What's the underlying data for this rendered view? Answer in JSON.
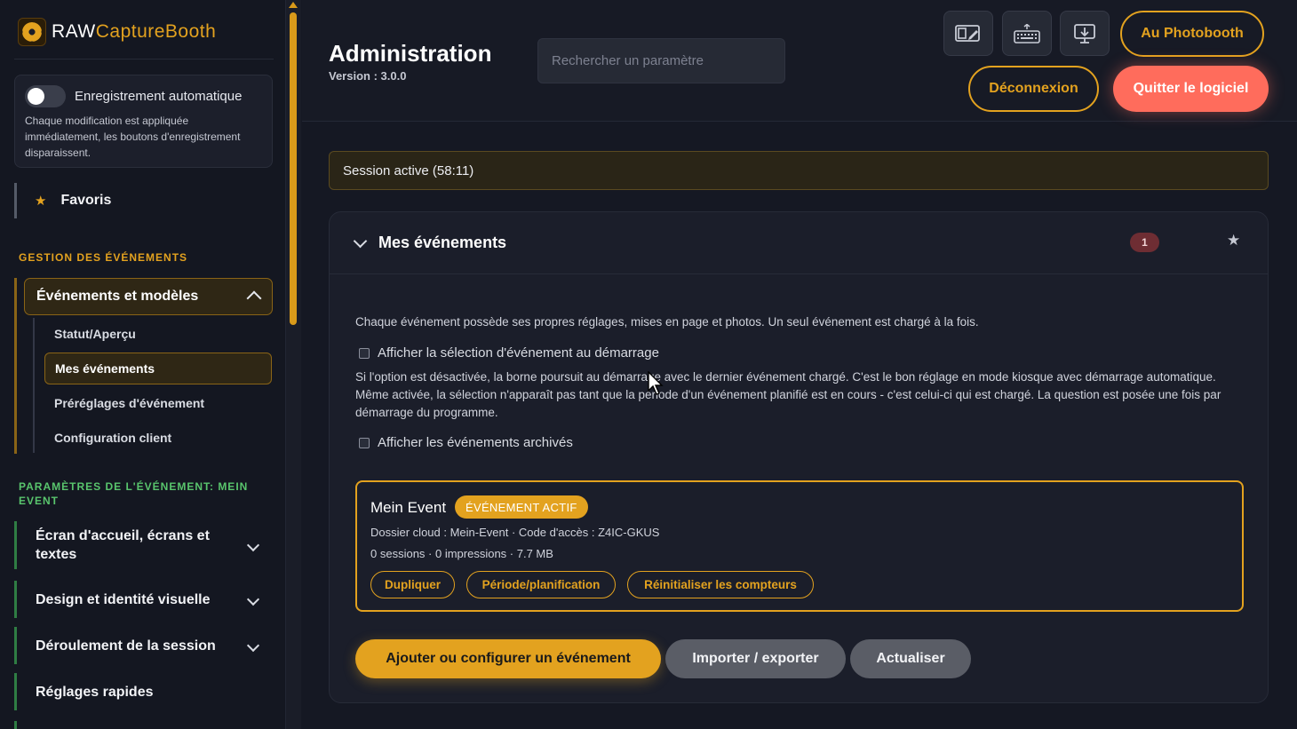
{
  "app": {
    "logo_raw": "RAW",
    "logo_capture": "CaptureBooth"
  },
  "autosave": {
    "title": "Enregistrement automatique",
    "description": "Chaque modification est appliquée immédiatement, les boutons d'enregistrement disparaissent.",
    "enabled": false
  },
  "sidebar": {
    "favorites_label": "Favoris",
    "events_section_title": "GESTION DES ÉVÉNEMENTS",
    "events_group_label": "Événements et modèles",
    "events_subitems": [
      {
        "label": "Statut/Aperçu"
      },
      {
        "label": "Mes événements"
      },
      {
        "label": "Préréglages d'événement"
      },
      {
        "label": "Configuration client"
      }
    ],
    "params_section_title": "PARAMÈTRES DE L'ÉVÉNEMENT: MEIN EVENT",
    "params_items": [
      {
        "label": "Écran d'accueil, écrans et textes"
      },
      {
        "label": "Design et identité visuelle"
      },
      {
        "label": "Déroulement de la session"
      },
      {
        "label": "Réglages rapides"
      }
    ]
  },
  "header": {
    "title": "Administration",
    "version": "Version : 3.0.0",
    "search_placeholder": "Rechercher un paramètre",
    "photobooth_button": "Au Photobooth",
    "logout_button": "Déconnexion",
    "quit_button": "Quitter le logiciel",
    "icons": [
      "layout-edit-icon",
      "keyboard-icon",
      "download-screen-icon"
    ]
  },
  "session_banner": "Session active (58:11)",
  "events_card": {
    "title": "Mes événements",
    "count": "1",
    "description": "Chaque événement possède ses propres réglages, mises en page et photos. Un seul événement est chargé à la fois.",
    "checkbox_show_selection": "Afficher la sélection d'événement au démarrage",
    "long_description": "Si l'option est désactivée, la borne poursuit au démarrage avec le dernier événement chargé. C'est le bon réglage en mode kiosque avec démarrage automatique. Même activée, la sélection n'apparaît pas tant que la période d'un événement planifié est en cours - c'est celui-ci qui est chargé. La question est posée une fois par démarrage du programme.",
    "checkbox_show_archived": "Afficher les événements archivés",
    "event": {
      "name": "Mein Event",
      "status_badge": "ÉVÉNEMENT ACTIF",
      "cloud_info": "Dossier cloud : Mein-Event · Code d'accès : Z4IC-GKUS",
      "stats": "0 sessions · 0 impressions · 7.7 MB",
      "actions": [
        "Dupliquer",
        "Période/planification",
        "Réinitialiser les compteurs"
      ]
    },
    "add_button": "Ajouter ou configurer un événement",
    "import_button": "Importer / exporter",
    "refresh_button": "Actualiser"
  },
  "colors": {
    "accent": "#e3a21f",
    "danger": "#ff6c5c",
    "green_section": "#59c56d",
    "background": "#151823"
  }
}
